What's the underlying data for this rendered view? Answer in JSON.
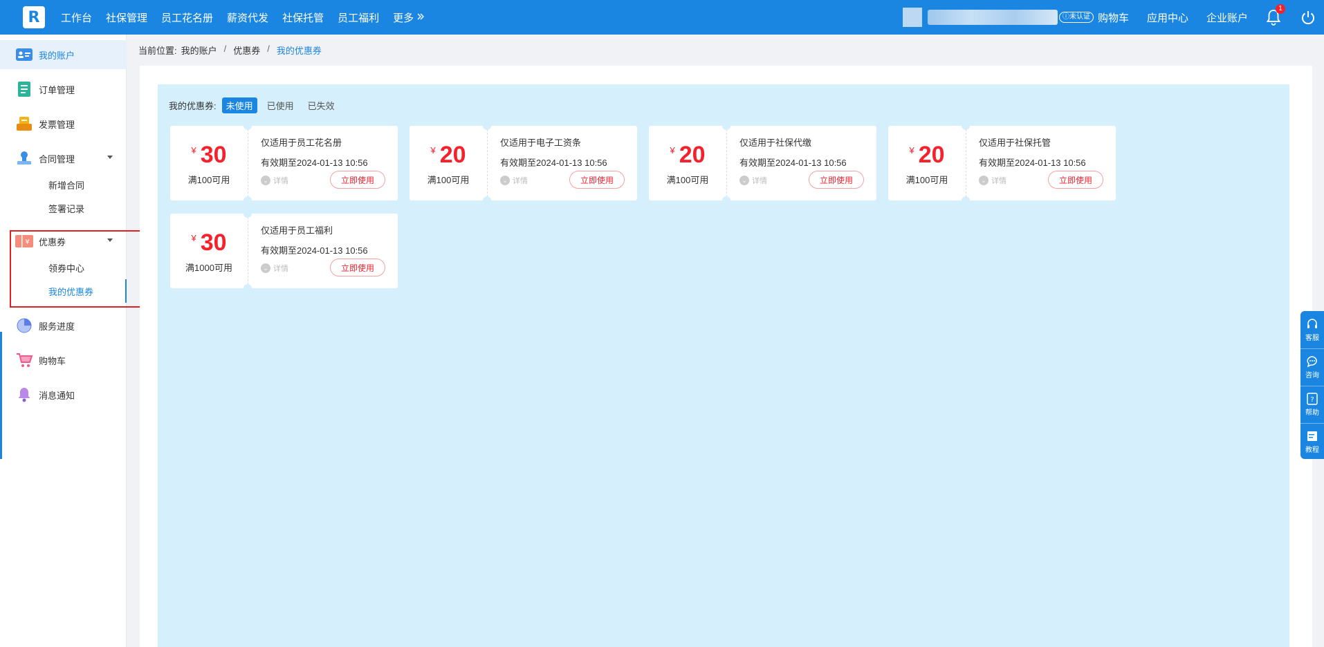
{
  "topbar": {
    "logo_text": "R",
    "nav": [
      "工作台",
      "社保管理",
      "员工花名册",
      "薪资代发",
      "社保托管",
      "员工福利"
    ],
    "more_label": "更多",
    "unverified_label": "未认证",
    "links": [
      "购物车",
      "应用中心",
      "企业账户"
    ],
    "notification_count": "1"
  },
  "sidebar": {
    "items": [
      {
        "label": "我的账户",
        "icon": "account-card-icon"
      },
      {
        "label": "订单管理",
        "icon": "order-doc-icon"
      },
      {
        "label": "发票管理",
        "icon": "invoice-icon"
      },
      {
        "label": "合同管理",
        "icon": "contract-stamp-icon"
      },
      {
        "label": "优惠券",
        "icon": "coupon-ticket-icon"
      },
      {
        "label": "服务进度",
        "icon": "progress-pie-icon"
      },
      {
        "label": "购物车",
        "icon": "cart-icon"
      },
      {
        "label": "消息通知",
        "icon": "bell-icon"
      }
    ],
    "contract_sub": [
      "新增合同",
      "签署记录"
    ],
    "coupon_sub": [
      "领券中心",
      "我的优惠券"
    ]
  },
  "breadcrumb": {
    "prefix": "当前位置:",
    "items": [
      "我的账户",
      "优惠券",
      "我的优惠券"
    ],
    "separator": "/"
  },
  "coupons_panel": {
    "title": "我的优惠券:",
    "tabs": [
      "未使用",
      "已使用",
      "已失效"
    ],
    "active_tab": "未使用"
  },
  "coupons": [
    {
      "currency": "¥",
      "amount": "30",
      "condition": "满100可用",
      "scope": "仅适用于员工花名册",
      "expire": "有效期至2024-01-13 10:56",
      "detail": "详情",
      "button": "立即使用"
    },
    {
      "currency": "¥",
      "amount": "20",
      "condition": "满100可用",
      "scope": "仅适用于电子工资条",
      "expire": "有效期至2024-01-13 10:56",
      "detail": "详情",
      "button": "立即使用"
    },
    {
      "currency": "¥",
      "amount": "20",
      "condition": "满100可用",
      "scope": "仅适用于社保代缴",
      "expire": "有效期至2024-01-13 10:56",
      "detail": "详情",
      "button": "立即使用"
    },
    {
      "currency": "¥",
      "amount": "20",
      "condition": "满100可用",
      "scope": "仅适用于社保托管",
      "expire": "有效期至2024-01-13 10:56",
      "detail": "详情",
      "button": "立即使用"
    },
    {
      "currency": "¥",
      "amount": "30",
      "condition": "满1000可用",
      "scope": "仅适用于员工福利",
      "expire": "有效期至2024-01-13 10:56",
      "detail": "详情",
      "button": "立即使用"
    }
  ],
  "float_bar": [
    "客服",
    "咨询",
    "帮助",
    "教程"
  ],
  "colors": {
    "brand": "#1a86e2",
    "coupon_red": "#f5222d",
    "panel_bg": "#d5f0fc"
  }
}
